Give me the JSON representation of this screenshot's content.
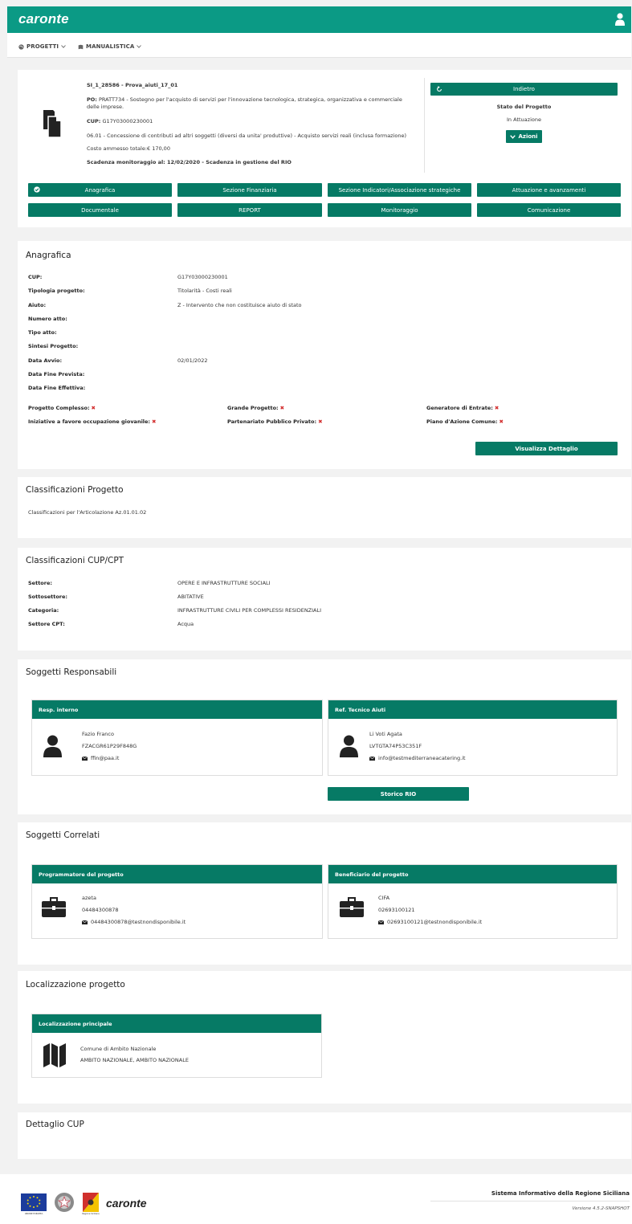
{
  "app": {
    "logo": "caronte"
  },
  "menu": {
    "progetti": "PROGETTI",
    "manualistica": "MANUALISTICA"
  },
  "project": {
    "title": "SI_1_28586 - Prova_aiuti_17_01",
    "po_label": "PO:",
    "po_value": "PRATT734 - Sostegno per l'acquisto di servizi per l'innovazione tecnologica, strategica, organizzativa e commerciale",
    "po_value2": "delle imprese.",
    "cup_label": "CUP:",
    "cup_value": "G17Y03000230001",
    "action": "06.01 - Concessione di contributi ad altri soggetti (diversi da unita' produttive) - Acquisto servizi reali (inclusa formazione)",
    "costo": "Costo ammesso totale:€ 170,00",
    "scadenza": "Scadenza monitoraggio al: 12/02/2020 - Scadenza in gestione del RIO"
  },
  "status": {
    "back_label": "Indietro",
    "stato_title": "Stato del Progetto",
    "stato_value": "In Attuazione",
    "azioni_label": "Azioni"
  },
  "tabs": {
    "anagrafica": "Anagrafica",
    "finanziaria": "Sezione Finanziaria",
    "indicatori": "Sezione Indicatori/Associazione strategiche",
    "attuazione": "Attuazione e avanzamenti",
    "documentale": "Documentale",
    "report": "REPORT",
    "monitoraggio": "Monitoraggio",
    "comunicazione": "Comunicazione"
  },
  "anagrafica": {
    "title": "Anagrafica",
    "rows": [
      {
        "label": "CUP:",
        "value": "G17Y03000230001"
      },
      {
        "label": "Tipologia progetto:",
        "value": "Titolarità - Costi reali"
      },
      {
        "label": "Aiuto:",
        "value": "Z - Intervento che non costituisce aiuto di stato"
      },
      {
        "label": "Numero atto:",
        "value": ""
      },
      {
        "label": "Tipo atto:",
        "value": ""
      },
      {
        "label": "Sintesi Progetto:",
        "value": ""
      },
      {
        "label": "Data Avvio:",
        "value": "02/01/2022"
      },
      {
        "label": "Data Fine Prevista:",
        "value": ""
      },
      {
        "label": "Data Fine Effettiva:",
        "value": ""
      }
    ],
    "flags": {
      "complesso": "Progetto Complesso:",
      "grande": "Grande Progetto:",
      "generatore": "Generatore di Entrate:",
      "giovanile": "Iniziative a favore occupazione giovanile:",
      "partenariato": "Partenariato Pubblico Privato:",
      "piano": "Piano d'Azione Comune:"
    },
    "detail_button": "Visualizza Dettaglio"
  },
  "classificazioni": {
    "title": "Classificazioni Progetto",
    "text": "Classificazioni per l'Articolazione Az.01.01.02"
  },
  "cupcpt": {
    "title": "Classificazioni CUP/CPT",
    "rows": [
      {
        "label": "Settore:",
        "value": "OPERE E INFRASTRUTTURE SOCIALI"
      },
      {
        "label": "Sottosettore:",
        "value": "ABITATIVE"
      },
      {
        "label": "Categoria:",
        "value": "INFRASTRUTTURE CIVILI PER COMPLESSI RESIDENZIALI"
      },
      {
        "label": "Settore CPT:",
        "value": "Acqua"
      }
    ]
  },
  "responsabili": {
    "title": "Soggetti Responsabili",
    "interno": {
      "head": "Resp. interno",
      "name": "Fazio Franco",
      "code": "FZACGR61P29F848G",
      "email": "ffin@paa.it"
    },
    "tecnico": {
      "head": "Ref. Tecnico Aiuti",
      "name": "Li Voti Agata",
      "code": "LVTGTA74P53C351F",
      "email": "info@testmediterraneacatering.it"
    },
    "storico_button": "Storico RIO"
  },
  "correlati": {
    "title": "Soggetti Correlati",
    "programmatore": {
      "head": "Programmatore del progetto",
      "name": "azeta",
      "code": "04484300878",
      "email": "04484300878@testnondisponibile.it"
    },
    "beneficiario": {
      "head": "Beneficiario del progetto",
      "name": "CIFA",
      "code": "02693100121",
      "email": "02693100121@testnondisponibile.it"
    }
  },
  "localizzazione": {
    "title": "Localizzazione progetto",
    "head": "Localizzazione principale",
    "line1": "Comune di Ambito Nazionale",
    "line2": "AMBITO NAZIONALE, AMBITO NAZIONALE"
  },
  "dettaglio_cup": {
    "title": "Dettaglio CUP"
  },
  "footer": {
    "logo": "caronte",
    "system": "Sistema Informativo della Regione Siciliana",
    "version": "Versione 4.5.2-SNAPSHOT",
    "eu_caption": "UNIONE EUROPEA",
    "sicily_caption": "Regione Siciliana"
  },
  "colors": {
    "header": "#0b9a85",
    "button": "#067a65",
    "flag_x": "#d32f2f"
  },
  "icons": [
    "user-icon",
    "globe-icon",
    "book-icon",
    "refresh-icon",
    "chevron-down-icon",
    "check-circle-icon",
    "documents-icon",
    "person-icon",
    "envelope-icon",
    "briefcase-icon",
    "map-icon",
    "close-icon"
  ]
}
